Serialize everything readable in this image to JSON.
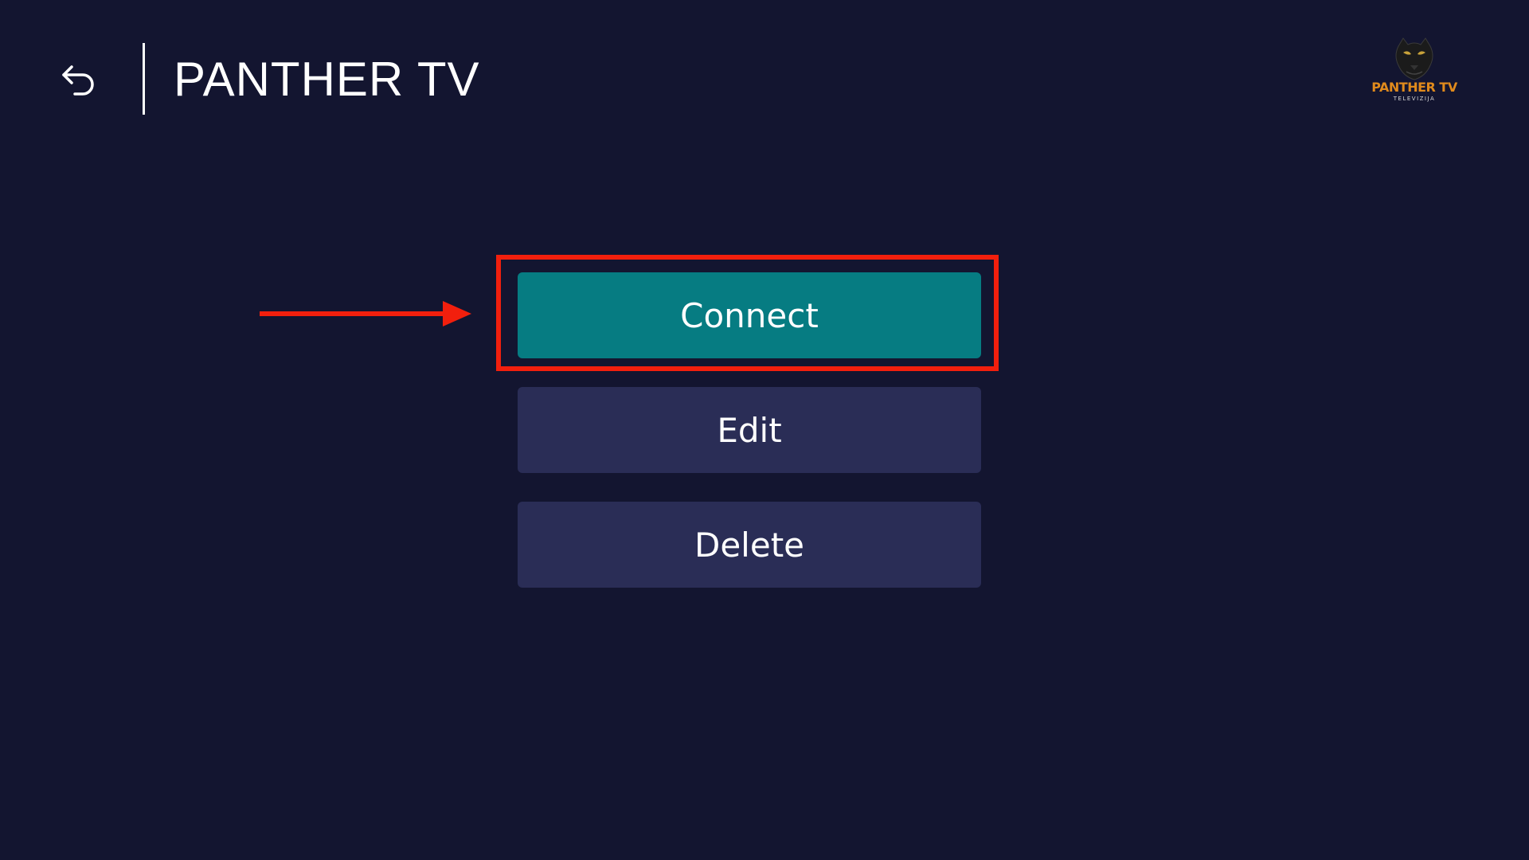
{
  "header": {
    "back_icon": "back-arrow-icon",
    "title": "PANTHER TV"
  },
  "logo": {
    "text": "PANTHER TV",
    "subtext": "TELEVIZIJA",
    "brand_color": "#e08a1c"
  },
  "menu": {
    "items": [
      {
        "label": "Connect",
        "active": true
      },
      {
        "label": "Edit",
        "active": false
      },
      {
        "label": "Delete",
        "active": false
      }
    ]
  },
  "annotation": {
    "highlight_color": "#f21f0d",
    "arrow_icon": "right-arrow-icon"
  },
  "colors": {
    "background": "#131530",
    "button": "#2a2d56",
    "button_active": "#067c82",
    "text": "#ffffff"
  }
}
